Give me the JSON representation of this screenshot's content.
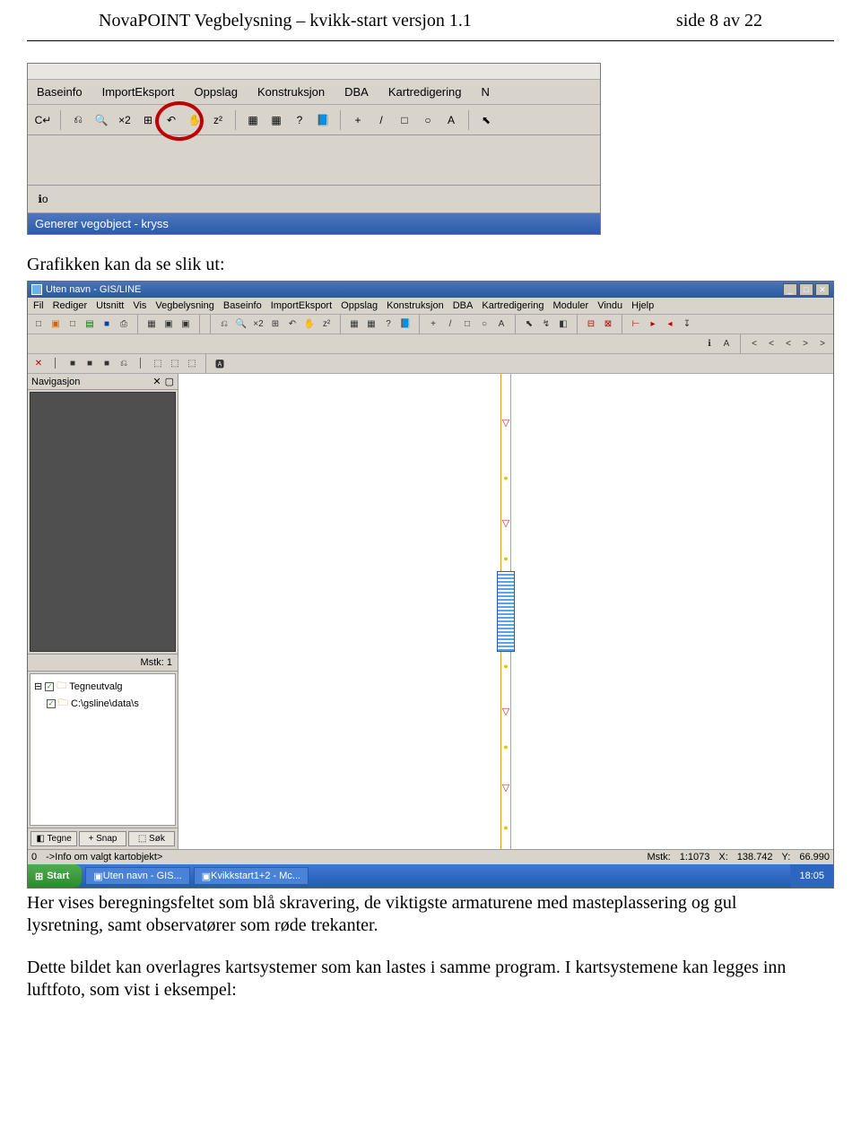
{
  "header": {
    "title_left": "NovaPOINT Vegbelysning – kvikk-start versjon 1.1",
    "title_right": "side 8 av 22"
  },
  "shot1": {
    "menu": [
      "Baseinfo",
      "ImportEksport",
      "Oppslag",
      "Konstruksjon",
      "DBA",
      "Kartredigering",
      "N"
    ],
    "toolbar_icons": [
      "C↵",
      "|",
      "⎌",
      "🔍",
      "×2",
      "⊞",
      "↶",
      "✋",
      "z²",
      "|",
      "▦",
      "▦",
      "?",
      "📘",
      "|",
      "+",
      "/",
      "□",
      "○",
      "A",
      "|",
      "⬉"
    ],
    "mini_icon": "ℹo",
    "status": "Generer vegobject - kryss"
  },
  "caption_after_shot1": "Grafikken kan da se slik ut:",
  "shot2": {
    "window_title": "Uten navn - GIS/LINE",
    "menu": [
      "Fil",
      "Rediger",
      "Utsnitt",
      "Vis",
      "Vegbelysning",
      "Baseinfo",
      "ImportEksport",
      "Oppslag",
      "Konstruksjon",
      "DBA",
      "Kartredigering",
      "Moduler",
      "Vindu",
      "Hjelp"
    ],
    "toolbar1": [
      "□",
      "▣",
      "□",
      "▤",
      "■",
      "⎙",
      "|",
      "▦",
      "▣",
      "▣",
      "|",
      "|",
      "⎌",
      "🔍",
      "×2",
      "⊞",
      "↶",
      "✋",
      "z²",
      "|",
      "▦",
      "▦",
      "?",
      "📘",
      "|",
      "+",
      "/",
      "□",
      "○",
      "A",
      "|",
      "⬉",
      "↯",
      "◧",
      "|",
      "⊟",
      "⊠",
      "|",
      "⊢",
      "▸",
      "◂",
      "↧"
    ],
    "toolbar2_right": [
      "ℹ",
      "A",
      "|",
      "<",
      "<",
      "<",
      ">",
      ">"
    ],
    "leftrow_icons": [
      "✕",
      "│",
      "■",
      "■",
      "■",
      "⎌",
      "│",
      "⬚",
      "⬚",
      "⬚",
      "|",
      "🅰"
    ],
    "navigator_label": "Navigasjon",
    "navigator_close": "✕",
    "navigator_box": "▢  ",
    "mstk_label": "Mstk:",
    "mstk_value": "1",
    "tree": {
      "root": "Tegneutvalg",
      "child": "C:\\gsline\\data\\s"
    },
    "side_buttons": [
      "◧ Tegne",
      "+ Snap",
      "⬚ Søk"
    ],
    "statusbar": {
      "hint": "->Info om valgt kartobjekt>",
      "mstk": "Mstk:",
      "scale": "1:1073",
      "x_lbl": "X:",
      "x_val": "138.742",
      "y_lbl": "Y:",
      "y_val": "66.990"
    },
    "taskbar": {
      "start": "Start",
      "task1": "Uten navn - GIS...",
      "task2": "Kvikkstart1+2 - Mc...",
      "clock": "18:05"
    }
  },
  "body_paragraphs": [
    "Her vises beregningsfeltet som blå skravering, de viktigste armaturene med masteplassering og gul lysretning, samt observatører som røde trekanter.",
    "Dette bildet kan overlagres kartsystemer som kan lastes i samme program. I kartsystemene kan legges inn luftfoto, som vist i eksempel:"
  ]
}
